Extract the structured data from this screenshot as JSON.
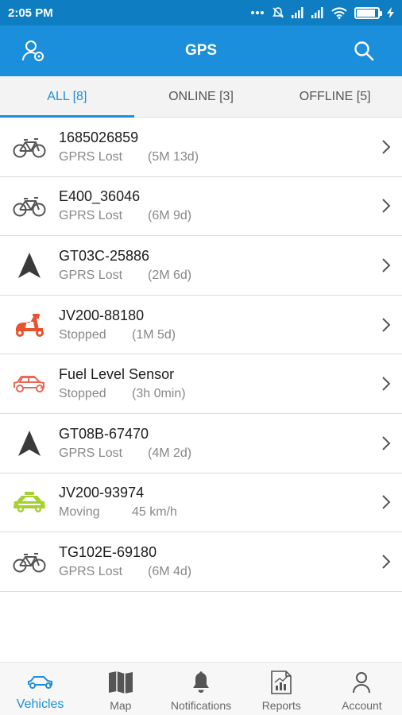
{
  "status_bar": {
    "time": "2:05 PM",
    "battery_level": 0.9,
    "icons": [
      "dots-icon",
      "silent-icon",
      "signal-icon",
      "signal-icon",
      "wifi-icon",
      "battery-icon",
      "charging-icon"
    ]
  },
  "app_bar": {
    "title": "GPS",
    "left_icon": "user-location-icon",
    "right_icon": "search-icon",
    "color": "#1b8fdc"
  },
  "tabs": [
    {
      "label": "ALL [8]",
      "active": true
    },
    {
      "label": "ONLINE [3]",
      "active": false
    },
    {
      "label": "OFFLINE [5]",
      "active": false
    }
  ],
  "vehicles": [
    {
      "name": "1685026859",
      "status": "GPRS Lost",
      "detail": "(5M 13d)",
      "icon": "bicycle-icon",
      "icon_color": "#555555"
    },
    {
      "name": "E400_36046",
      "status": "GPRS Lost",
      "detail": "(6M 9d)",
      "icon": "bicycle-icon",
      "icon_color": "#555555"
    },
    {
      "name": "GT03C-25886",
      "status": "GPRS Lost",
      "detail": "(2M 6d)",
      "icon": "navigation-arrow-icon",
      "icon_color": "#3a3a3a"
    },
    {
      "name": "JV200-88180",
      "status": "Stopped",
      "detail": "(1M 5d)",
      "icon": "scooter-icon",
      "icon_color": "#e8532e"
    },
    {
      "name": "Fuel Level Sensor",
      "status": "Stopped",
      "detail": "(3h 0min)",
      "icon": "car-icon",
      "icon_color": "#e86a55"
    },
    {
      "name": "GT08B-67470",
      "status": "GPRS Lost",
      "detail": "(4M 2d)",
      "icon": "navigation-arrow-icon",
      "icon_color": "#3a3a3a"
    },
    {
      "name": "JV200-93974",
      "status": "Moving",
      "detail": "45 km/h",
      "icon": "taxi-icon",
      "icon_color": "#a5d12e"
    },
    {
      "name": "TG102E-69180",
      "status": "GPRS Lost",
      "detail": "(6M 4d)",
      "icon": "bicycle-icon",
      "icon_color": "#555555"
    }
  ],
  "bottom_nav": [
    {
      "label": "Vehicles",
      "icon": "car-icon",
      "active": true
    },
    {
      "label": "Map",
      "icon": "map-icon",
      "active": false
    },
    {
      "label": "Notifications",
      "icon": "bell-icon",
      "active": false
    },
    {
      "label": "Reports",
      "icon": "chart-report-icon",
      "active": false
    },
    {
      "label": "Account",
      "icon": "person-icon",
      "active": false
    }
  ]
}
